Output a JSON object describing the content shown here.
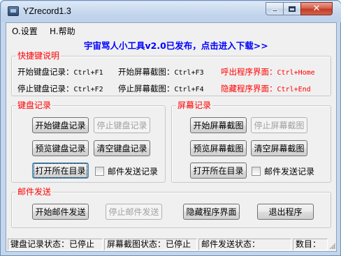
{
  "window": {
    "title": "YZrecord1.3",
    "close_glyph": "✕"
  },
  "menu": {
    "settings": "O.设置",
    "help": "H.帮助"
  },
  "banner": "宇宙骂人小工具v2.0已发布，点击进入下载>>",
  "shortcuts": {
    "title": "快捷键说明",
    "items": [
      {
        "label": "开始键盘记录：",
        "key": "Ctrl+F1"
      },
      {
        "label": "开始屏幕截图：",
        "key": "Ctrl+F3"
      },
      {
        "label": "呼出程序界面：",
        "key": "Ctrl+Home"
      },
      {
        "label": "停止键盘记录：",
        "key": "Ctrl+F2"
      },
      {
        "label": "停止屏幕截图：",
        "key": "Ctrl+F4"
      },
      {
        "label": "隐藏程序界面：",
        "key": "Ctrl+End"
      }
    ]
  },
  "keyboard": {
    "title": "键盘记录",
    "start": "开始键盘记录",
    "stop": "停止键盘记录",
    "preview": "预览键盘记录",
    "clear": "清空键盘记录",
    "open_dir": "打开所在目录",
    "mail_check": "邮件发送记录"
  },
  "screen": {
    "title": "屏幕记录",
    "start": "开始屏幕截图",
    "stop": "停止屏幕截图",
    "preview": "预览屏幕截图",
    "clear": "清空屏幕截图",
    "open_dir": "打开所在目录",
    "mail_check": "邮件发送记录"
  },
  "mail": {
    "title": "邮件发送",
    "start": "开始邮件发送",
    "stop": "停止邮件发送",
    "hide": "隐藏程序界面",
    "exit": "退出程序"
  },
  "status": {
    "keyboard": "键盘记录状态：已停止",
    "screen": "屏幕截图状态：已停止",
    "mail": "邮件发送状态：",
    "count": "数目："
  },
  "colors": {
    "group_title": "#ff0000",
    "banner": "#0000ff",
    "highlight_shortcut": "#ff0000"
  }
}
